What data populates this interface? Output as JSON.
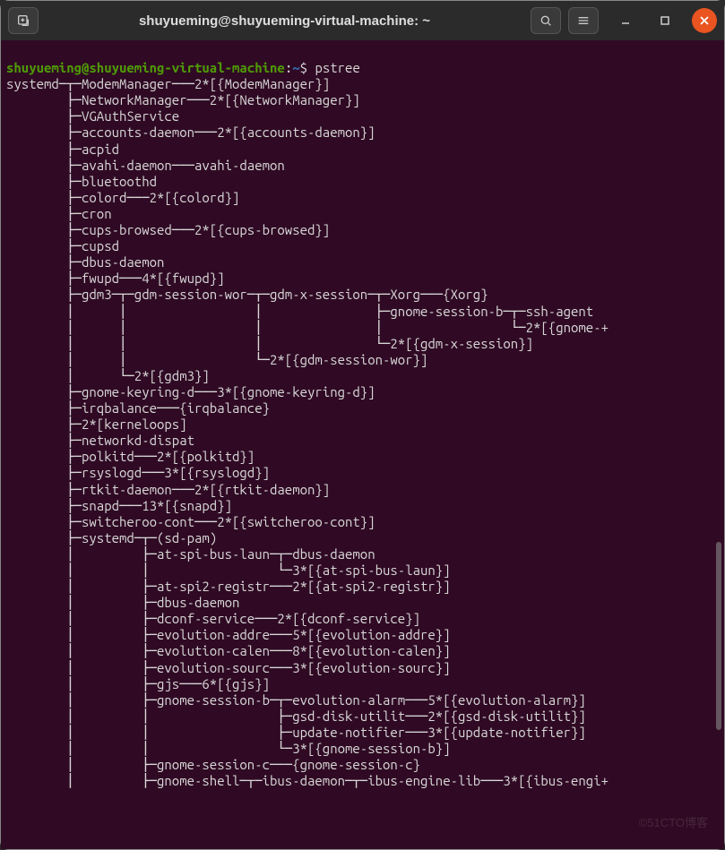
{
  "window": {
    "title": "shuyueming@shuyueming-virtual-machine: ~"
  },
  "prompt": {
    "user_host": "shuyueming@shuyueming-virtual-machine",
    "sep1": ":",
    "path": "~",
    "sep2": "$ ",
    "command": "pstree"
  },
  "tree_lines": [
    "systemd─┬─ModemManager───2*[{ModemManager}]",
    "        ├─NetworkManager───2*[{NetworkManager}]",
    "        ├─VGAuthService",
    "        ├─accounts-daemon───2*[{accounts-daemon}]",
    "        ├─acpid",
    "        ├─avahi-daemon───avahi-daemon",
    "        ├─bluetoothd",
    "        ├─colord───2*[{colord}]",
    "        ├─cron",
    "        ├─cups-browsed───2*[{cups-browsed}]",
    "        ├─cupsd",
    "        ├─dbus-daemon",
    "        ├─fwupd───4*[{fwupd}]",
    "        ├─gdm3─┬─gdm-session-wor─┬─gdm-x-session─┬─Xorg───{Xorg}",
    "        │      │                 │               ├─gnome-session-b─┬─ssh-agent",
    "        │      │                 │               │                 └─2*[{gnome-+",
    "        │      │                 │               └─2*[{gdm-x-session}]",
    "        │      │                 └─2*[{gdm-session-wor}]",
    "        │      └─2*[{gdm3}]",
    "        ├─gnome-keyring-d───3*[{gnome-keyring-d}]",
    "        ├─irqbalance───{irqbalance}",
    "        ├─2*[kerneloops]",
    "        ├─networkd-dispat",
    "        ├─polkitd───2*[{polkitd}]",
    "        ├─rsyslogd───3*[{rsyslogd}]",
    "        ├─rtkit-daemon───2*[{rtkit-daemon}]",
    "        ├─snapd───13*[{snapd}]",
    "        ├─switcheroo-cont───2*[{switcheroo-cont}]",
    "        ├─systemd─┬─(sd-pam)",
    "        │         ├─at-spi-bus-laun─┬─dbus-daemon",
    "        │         │                 └─3*[{at-spi-bus-laun}]",
    "        │         ├─at-spi2-registr───2*[{at-spi2-registr}]",
    "        │         ├─dbus-daemon",
    "        │         ├─dconf-service───2*[{dconf-service}]",
    "        │         ├─evolution-addre───5*[{evolution-addre}]",
    "        │         ├─evolution-calen───8*[{evolution-calen}]",
    "        │         ├─evolution-sourc───3*[{evolution-sourc}]",
    "        │         ├─gjs───6*[{gjs}]",
    "        │         ├─gnome-session-b─┬─evolution-alarm───5*[{evolution-alarm}]",
    "        │         │                 ├─gsd-disk-utilit───2*[{gsd-disk-utilit}]",
    "        │         │                 ├─update-notifier───3*[{update-notifier}]",
    "        │         │                 └─3*[{gnome-session-b}]",
    "        │         ├─gnome-session-c───{gnome-session-c}",
    "        │         ├─gnome-shell─┬─ibus-daemon─┬─ibus-engine-lib───3*[{ibus-engi+"
  ],
  "watermark": "©51CTO博客"
}
